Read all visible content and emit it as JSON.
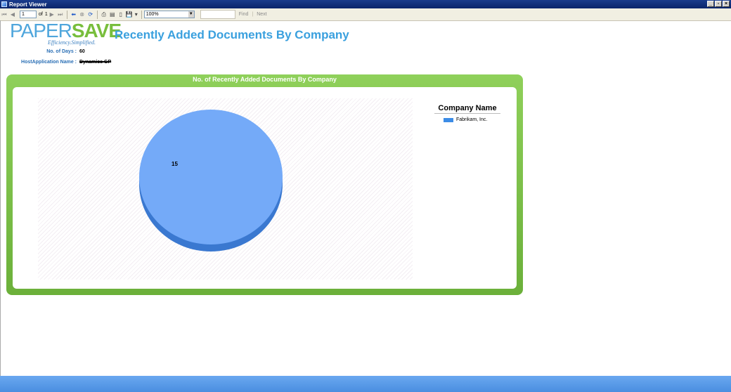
{
  "window": {
    "title": "Report Viewer"
  },
  "toolbar": {
    "page_current": "1",
    "page_of_label": "of",
    "page_total": "1",
    "zoom": "100%",
    "find_label": "Find",
    "next_label": "Next"
  },
  "logo": {
    "paper": "PAPER",
    "save": "SAVE",
    "tagline": "Efficiency.Simplified."
  },
  "report": {
    "title": "Recently Added Documents By Company",
    "params": [
      {
        "label": "No. of Days :",
        "value": "60"
      },
      {
        "label": "HostApplication Name :",
        "value": "Dynamics GP"
      }
    ]
  },
  "chart_data": {
    "type": "pie",
    "title": "No. of Recently Added Documents By Company",
    "legend_title": "Company Name",
    "legend_position": "right",
    "categories": [
      "Fabrikam, Inc."
    ],
    "values": [
      15
    ],
    "colors": {
      "slice": "#74aaf8",
      "slice_side": "#3a78d0",
      "legend": "#3c8ce6"
    }
  }
}
